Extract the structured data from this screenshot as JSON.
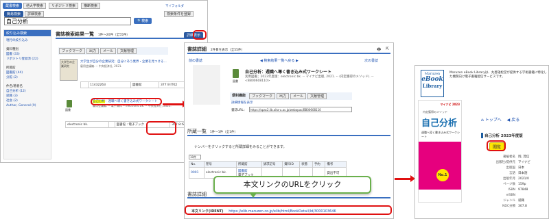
{
  "panel1": {
    "tabs": [
      "蔵書検索",
      "他大学検索",
      "リポジトリ検索",
      "横断検索"
    ],
    "subtabs": [
      "簡易検索",
      "詳細検索"
    ],
    "search_value": "自己分析",
    "search_button": "検索",
    "myfile_link": "マイフォルダ",
    "save_condition": "検索条件を登録",
    "sidebar_title": "絞り込み検索",
    "sidebar_items": [
      "現行の絞り込み",
      "資料種別",
      "図書 (33)",
      "リポジトリ登録済 (22)",
      "所蔵館",
      "図書館 (44)",
      "分館 (2)",
      "件名/著者名",
      "自己分析 (12)",
      "就職 (3)",
      "社会 (2)",
      "Author, General (9)"
    ],
    "results_title": "書誌検索結果一覧",
    "results_count": "1件〜20件（全55件）",
    "detail_button": "詳細表示",
    "toolbar": [
      "ブックマーク",
      "出力",
      "メール",
      "文献管理"
    ],
    "item1_title": "大学生が自分の企業研究：自分にあう業界・企業を見つける...",
    "item1_meta": "雇用会議編. -- 中央経済社, 2021.",
    "item1_cover": "大学生の企業研究",
    "item1_row": [
      "",
      "11432263",
      "図書館",
      "377.9:ITK2"
    ],
    "item2_title_hl": "自己分析",
    "item2_title": "：週職へ導く書き込み式ワークシート",
    "item2_meta": "雇用会議編. -- 電子資料 -- electronic bk. -- 中央経済社, 2021.",
    "item2_row_label": "電子資料",
    "item2_row": [
      "electronic bk.",
      "",
      "図書館 : 電子ブック",
      "307.8:ISE"
    ],
    "item2_type": "図書"
  },
  "panel2": {
    "title": "書誌詳細",
    "count": "2件目を表示（全55件）",
    "nav_prev": "前の書誌",
    "nav_back": "◀ 検索結果一覧へ戻る ▶",
    "nav_next": "次の書誌",
    "book_title": "自己分析：週職へ導く書き込み式ワークシート",
    "book_meta": "実用図書；2023年度版：electronic bk. -- マイナビ出版, 2021. -- (内定獲得のメソッド). -- <BB00608110>",
    "book_type": "図書",
    "tools_label": "便利機能",
    "tools": [
      "ブックマーク",
      "出力",
      "メール",
      "文献管理"
    ],
    "detail_link": "詳細情報を表示",
    "url_label": "書誌URL：",
    "url_value": "https://opac2.lib.oita-u.ac.jp/webopac/BB00608110",
    "holdings_title": "所蔵一覧",
    "holdings_count": "1件〜1件（全1件）",
    "holdings_hint": "ナンバーをクリックすると所蔵詳細をみることができます。",
    "per_page": "10件",
    "holding_headers": [
      "No.",
      "巻号",
      "所蔵館",
      "請求記号",
      "資料ID",
      "状態",
      "予約",
      "備考"
    ],
    "holding_row": [
      "0001",
      "electronic bk.",
      "電子ブック",
      "",
      "",
      "",
      "",
      "貸出不可"
    ],
    "library_link": "図書館",
    "bib_title": "書誌詳細",
    "fulltext_label": "本文リンク(IDENT)",
    "fulltext_url": "https://elib.maruzen.co.jp/elib/html/BookDetail/Id/3000103646",
    "callout": "本文リンクのURLをクリック"
  },
  "panel3": {
    "brand_top": "Maruzen",
    "brand_main": "eBook",
    "brand_sub": "Library",
    "header_text": "Maruzen eBook Libraryは、丸善雄松堂が提供する学術書籍に特化した機関向け電子書籍配信サービスです。",
    "nav_top": "トップへ",
    "nav_back": "戻る",
    "book_title": "自己分析 2023年度版",
    "read_button": "閲覧",
    "cover_series": "内定獲得のメソッド",
    "cover_title": "自己分析",
    "cover_sub": "週職へ導く書き込み式ワークシート",
    "cover_badge": "マイナビ 2023",
    "cover_yellow": "No.1",
    "info": [
      [
        "著編者名",
        "岡, 茂信"
      ],
      [
        "出版社/提供元",
        "マイナビ"
      ],
      [
        "出版国",
        "日本"
      ],
      [
        "言語",
        "日本語"
      ],
      [
        "出版年月",
        "2021/0"
      ],
      [
        "ページ数",
        "159p"
      ],
      [
        "ISBN",
        "97848"
      ],
      [
        "eISBN",
        ""
      ],
      [
        "ジャンル",
        "就職"
      ],
      [
        "NDC分類",
        "307.8"
      ]
    ]
  },
  "colors": {
    "accent": "#e01010",
    "blue": "#3a6fc0",
    "green": "#4caf50"
  }
}
